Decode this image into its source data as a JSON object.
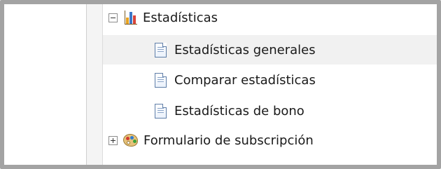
{
  "tree": {
    "items": [
      {
        "label": "Estadísticas",
        "icon": "bar-chart-icon",
        "toggle": "collapse",
        "expanded": true
      },
      {
        "label": "Estadísticas generales",
        "icon": "document-icon",
        "selected": true
      },
      {
        "label": "Comparar estadísticas",
        "icon": "document-icon"
      },
      {
        "label": "Estadísticas de bono",
        "icon": "document-icon"
      },
      {
        "label": "Formulario de subscripción",
        "icon": "palette-icon",
        "toggle": "expand",
        "expanded": false
      }
    ]
  },
  "colors": {
    "frame_border": "#a3a3a3",
    "selected_row": "#f1f1f1",
    "gutter": "#f4f4f4",
    "text": "#1a1a1a"
  }
}
